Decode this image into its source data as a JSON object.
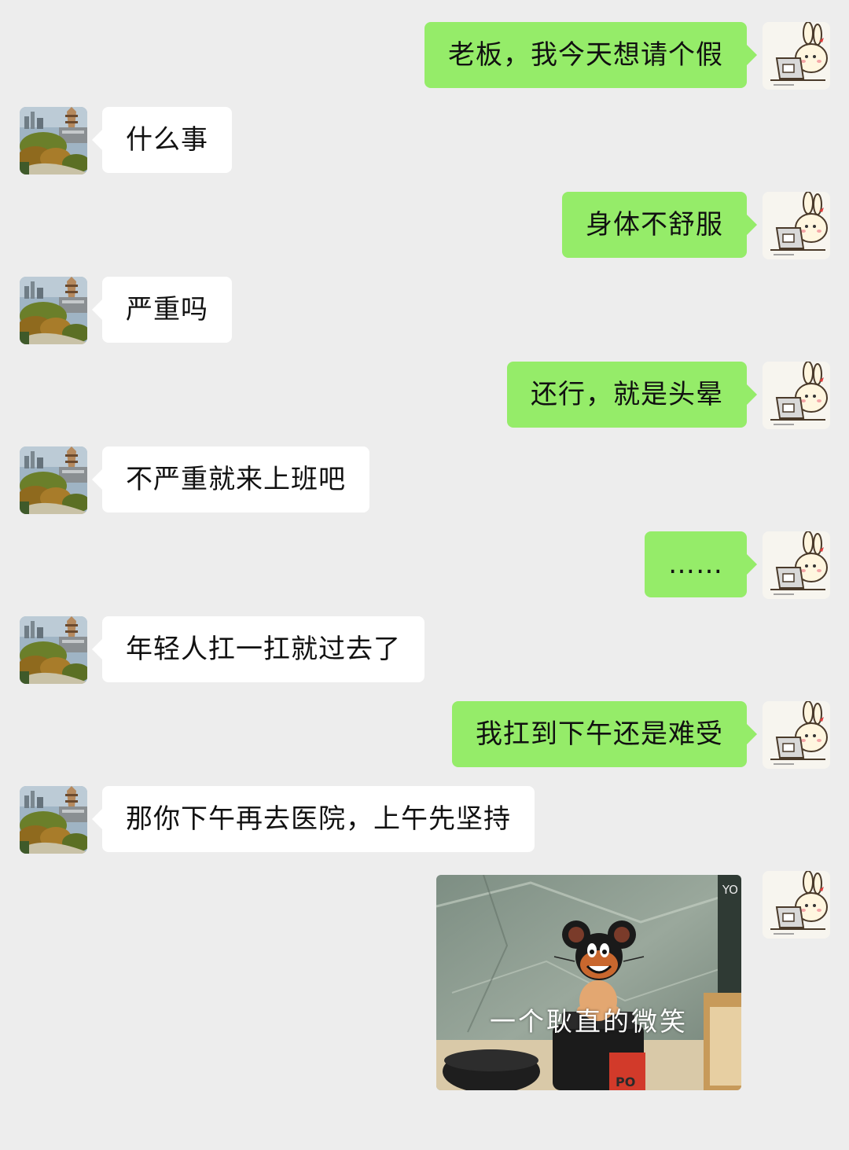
{
  "colors": {
    "background": "#ededed",
    "my_bubble": "#95ec69",
    "their_bubble": "#ffffff"
  },
  "messages": [
    {
      "sender": "me",
      "text": "老板，我今天想请个假"
    },
    {
      "sender": "boss",
      "text": "什么事"
    },
    {
      "sender": "me",
      "text": "身体不舒服"
    },
    {
      "sender": "boss",
      "text": "严重吗"
    },
    {
      "sender": "me",
      "text": "还行，就是头晕"
    },
    {
      "sender": "boss",
      "text": "不严重就来上班吧"
    },
    {
      "sender": "me",
      "text": "……"
    },
    {
      "sender": "boss",
      "text": "年轻人扛一扛就过去了"
    },
    {
      "sender": "me",
      "text": "我扛到下午还是难受"
    },
    {
      "sender": "boss",
      "text": "那你下午再去医院，上午先坚持"
    },
    {
      "sender": "me",
      "type": "sticker",
      "caption": "一个耿直的微笑",
      "corner_text": "YO",
      "bottle_text": "PO"
    }
  ],
  "avatars": {
    "me": "bunny-at-laptop-icon",
    "boss": "city-landscape-photo"
  }
}
